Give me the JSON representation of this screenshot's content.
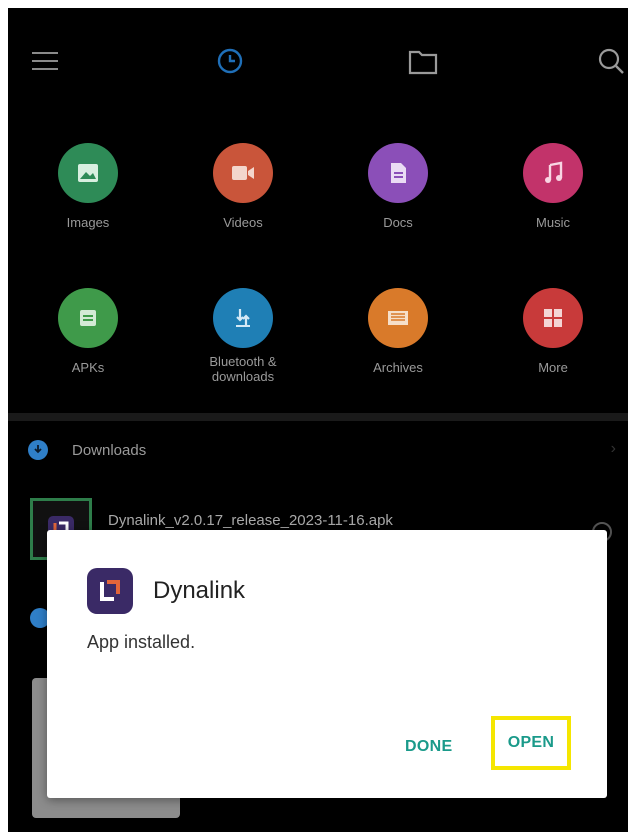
{
  "topbar": {
    "icons": [
      "menu-icon",
      "recent-clock-icon",
      "folder-icon",
      "search-icon"
    ],
    "accent": "#1f6fb8"
  },
  "categories": [
    {
      "label": "Images",
      "icon": "image-icon",
      "color": "#2e8b57"
    },
    {
      "label": "Videos",
      "icon": "video-icon",
      "color": "#c9553a"
    },
    {
      "label": "Docs",
      "icon": "document-icon",
      "color": "#8b4fb8"
    },
    {
      "label": "Music",
      "icon": "music-icon",
      "color": "#c2336a"
    },
    {
      "label": "APKs",
      "icon": "apk-icon",
      "color": "#3f9a4a"
    },
    {
      "label": "Bluetooth &\ndownloads",
      "icon": "bluetooth-download-icon",
      "color": "#1f7fb5"
    },
    {
      "label": "Archives",
      "icon": "archive-icon",
      "color": "#d97a2a"
    },
    {
      "label": "More",
      "icon": "grid-icon",
      "color": "#c83a3a"
    }
  ],
  "downloads": {
    "title": "Downloads",
    "file_name": "Dynalink_v2.0.17_release_2023-11-16.apk"
  },
  "dialog": {
    "app_name": "Dynalink",
    "message": "App installed.",
    "done_label": "DONE",
    "open_label": "OPEN",
    "button_color": "#1a9a8a",
    "highlight_color": "#f5e600"
  }
}
